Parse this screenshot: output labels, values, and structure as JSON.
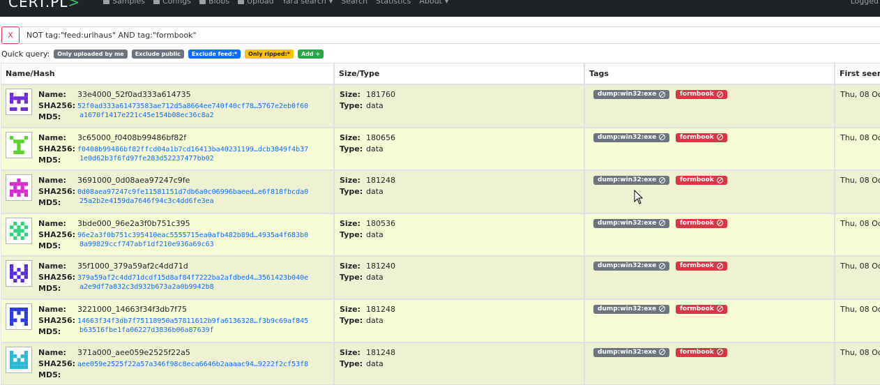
{
  "navbar": {
    "brand": "CERT.PL",
    "items": [
      {
        "label": "Samples",
        "icon": "file-icon"
      },
      {
        "label": "Configs",
        "icon": "table-icon"
      },
      {
        "label": "Blobs",
        "icon": "database-icon"
      },
      {
        "label": "Upload",
        "icon": "upload-icon"
      },
      {
        "label": "Yara search",
        "caret": true
      },
      {
        "label": "Search"
      },
      {
        "label": "Statistics"
      },
      {
        "label": "About",
        "caret": true
      }
    ],
    "logged": "Logged"
  },
  "search": {
    "clear_label": "X",
    "query": "NOT tag:\"feed:urlhaus\" AND tag:\"formbook\""
  },
  "quick_query": {
    "label": "Quick query:",
    "buttons": [
      {
        "label": "Only uploaded by me",
        "color": "#6c757d"
      },
      {
        "label": "Exclude public",
        "color": "#6c757d"
      },
      {
        "label": "Exclude feed:*",
        "color": "#0d6efd"
      },
      {
        "label": "Only ripped:*",
        "color": "#ffc107"
      },
      {
        "label": "Add +",
        "color": "#28a745"
      }
    ]
  },
  "table": {
    "headers": [
      "Name/Hash",
      "Size/Type",
      "Tags",
      "First seen"
    ],
    "labels": {
      "name": "Name:",
      "sha256": "SHA256:",
      "md5": "MD5:",
      "size": "Size:",
      "type": "Type:"
    },
    "rows": [
      {
        "name": "33e4000_52f0ad333a614735",
        "sha256": "52f0ad333a61473583ae712d5a8664ee740f40cf78…5767e2eb0f60",
        "md5": "a1670f1417e221c45e154b08ec36c8a2",
        "size": "181760",
        "type": "data",
        "tags": [
          "dump:win32:exe",
          "formbook"
        ],
        "date": "Thu, 08 Oc",
        "identicon_color": "#6f2bd6"
      },
      {
        "name": "3c65000_f0408b99486bf82f",
        "sha256": "f0408b99486bf82ffcd04a1b7cd16413ba40231199…dcb3849f4b37",
        "md5": "1e0d62b3f6fd97fe283d52237477bb02",
        "size": "180656",
        "type": "data",
        "tags": [
          "dump:win32:exe",
          "formbook"
        ],
        "date": "Thu, 08 Oc",
        "identicon_color": "#5bd22b"
      },
      {
        "name": "3691000_0d08aea97247c9fe",
        "sha256": "0d08aea97247c9fe11581151d7db6a0c06996baeed…e6f818fbcda0",
        "md5": "25a2b2e4159da7646f94c3c4dd6fe3ea",
        "size": "181248",
        "type": "data",
        "tags": [
          "dump:win32:exe",
          "formbook"
        ],
        "date": "Thu, 08 Oc",
        "identicon_color": "#d62bd0"
      },
      {
        "name": "3bde000_96e2a3f0b751c395",
        "sha256": "96e2a3f0b751c395410eac5555715ea0afb482b89d…4935a4f683b0",
        "md5": "8a99829ccf747abf1df210e936a69c63",
        "size": "180536",
        "type": "data",
        "tags": [
          "dump:win32:exe",
          "formbook"
        ],
        "date": "Thu, 08 Oc",
        "identicon_color": "#2bd67a"
      },
      {
        "name": "35f1000_379a59af2c4dd71d",
        "sha256": "379a59af2c4dd71dcdf15d8af84f7222ba2afdbed4…3561423b040e",
        "md5": "a2e9df7a832c3d932b673a2a0b9942b8",
        "size": "181240",
        "type": "data",
        "tags": [
          "dump:win32:exe",
          "formbook"
        ],
        "date": "Thu, 08 Oc",
        "identicon_color": "#5b2bd6"
      },
      {
        "name": "3221000_14663f34f3db7f75",
        "sha256": "14663f34f3db7f75118950a57811612b9fa6136328…f3b9c69af845",
        "md5": "b63516fbe1fa06227d3836b06a87639f",
        "size": "181248",
        "type": "data",
        "tags": [
          "dump:win32:exe",
          "formbook"
        ],
        "date": "Thu, 08 Oc",
        "identicon_color": "#2b3bd6"
      },
      {
        "name": "371a000_aee059e2525f22a5",
        "sha256": "aee059e2525f22a57a346f98c8eca6646b2aaaac94…9222f2cf53f8",
        "md5": "",
        "size": "181248",
        "type": "data",
        "tags": [
          "dump:win32:exe",
          "formbook"
        ],
        "date": "Thu, 08 Oc",
        "identicon_color": "#2bb8d6"
      }
    ]
  }
}
